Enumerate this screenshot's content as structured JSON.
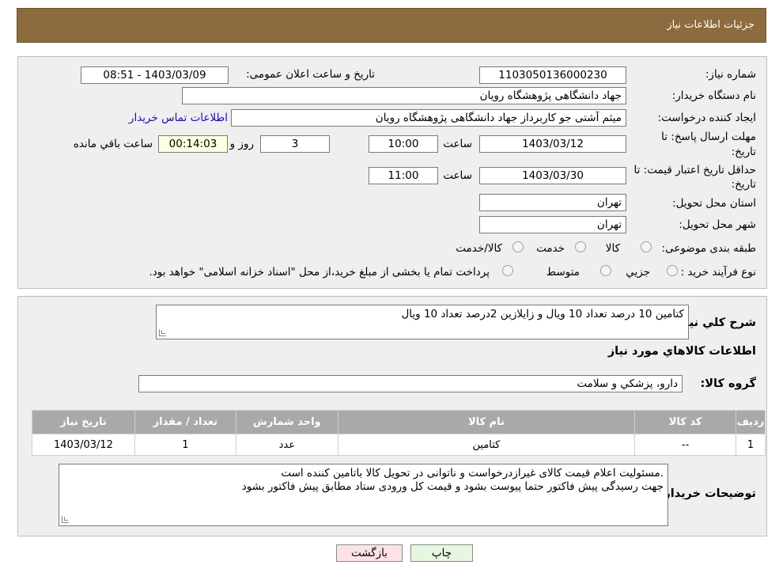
{
  "header": {
    "title": "جزئیات اطلاعات نیاز"
  },
  "need": {
    "number_label": "شماره نیاز:",
    "number": "1103050136000230",
    "announce_label": "تاریخ و ساعت اعلان عمومی:",
    "announce_value": "1403/03/09 - 08:51",
    "buyer_label": "نام دستگاه خریدار:",
    "buyer": "جهاد دانشگاهی پژوهشگاه رویان",
    "creator_label": "ایجاد کننده درخواست:",
    "creator": "میثم  آشتی جو کاربرداز جهاد دانشگاهی پژوهشگاه رویان",
    "contact_link": "اطلاعات تماس خریدار",
    "deadline_label_1": "مهلت ارسال پاسخ: تا",
    "deadline_label_2": "تاریخ:",
    "deadline_date": "1403/03/12",
    "time_word": "ساعت",
    "deadline_time": "10:00",
    "days": "3",
    "days_word": "روز و",
    "remaining": "00:14:03",
    "remaining_word": "ساعت باقي مانده",
    "validity_label_1": "حداقل تاریخ اعتبار قیمت: تا",
    "validity_label_2": "تاریخ:",
    "validity_date": "1403/03/30",
    "validity_time": "11:00",
    "province_label": "استان محل تحویل:",
    "province": "تهران",
    "city_label": "شهر محل تحویل:",
    "city": "تهران",
    "category_label": "طبقه بندی موضوعی:",
    "category_options": [
      "کالا",
      "خدمت",
      "کالا/خدمت"
    ],
    "process_label": "نوع فرآیند خرید :",
    "process_options": [
      "جزیي",
      "متوسط"
    ],
    "process_note": "پرداخت تمام یا بخشی از مبلغ خرید،از محل \"اسناد خزانه اسلامی\" خواهد بود."
  },
  "details": {
    "summary_label": "شرح كلي نياز:",
    "summary": "کتامین 10 درصد تعداد 10 ویال و زایلازین 2درصد تعداد 10 ویال",
    "items_heading": "اطلاعات كالاهاي مورد نياز",
    "group_label": "گروه کالا:",
    "group": "دارو، پزشكي و سلامت",
    "table": {
      "headers": [
        "رديف",
        "كد كالا",
        "نام كالا",
        "واحد شمارش",
        "تعداد / مقدار",
        "تاریخ نیاز"
      ],
      "rows": [
        [
          "1",
          "--",
          "کتامین",
          "عدد",
          "1",
          "1403/03/12"
        ]
      ]
    },
    "buyer_notes_label": "توضیحات خریدار:",
    "buyer_notes_1": ".مسئولیت اعلام قیمت کالای غیرازدرخواست و ناتوانی در تحویل کالا باتامین کننده است",
    "buyer_notes_2": "جهت رسیدگی پیش فاکتور حتما پیوست بشود و قیمت کل ورودی ستاد مطابق پیش فاکتور بشود"
  },
  "buttons": {
    "print": "چاپ",
    "back": "بازگشت"
  },
  "colors": {
    "header": "#8c6b3e",
    "table_header": "#a9a9a9",
    "panel": "#efefef"
  }
}
